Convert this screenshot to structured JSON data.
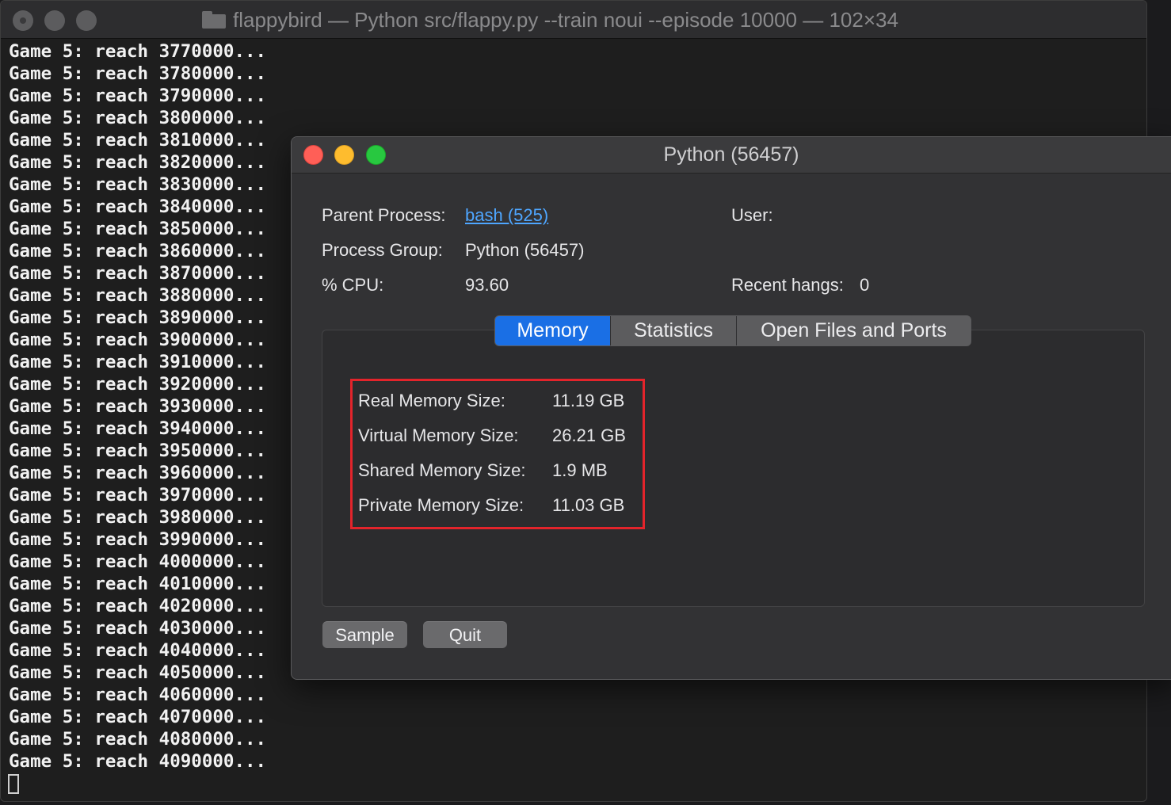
{
  "terminal": {
    "title": "flappybird — Python src/flappy.py --train noui --episode 10000 — 102×34",
    "lines": [
      "Game 5: reach 3770000...",
      "Game 5: reach 3780000...",
      "Game 5: reach 3790000...",
      "Game 5: reach 3800000...",
      "Game 5: reach 3810000...",
      "Game 5: reach 3820000...",
      "Game 5: reach 3830000...",
      "Game 5: reach 3840000...",
      "Game 5: reach 3850000...",
      "Game 5: reach 3860000...",
      "Game 5: reach 3870000...",
      "Game 5: reach 3880000...",
      "Game 5: reach 3890000...",
      "Game 5: reach 3900000...",
      "Game 5: reach 3910000...",
      "Game 5: reach 3920000...",
      "Game 5: reach 3930000...",
      "Game 5: reach 3940000...",
      "Game 5: reach 3950000...",
      "Game 5: reach 3960000...",
      "Game 5: reach 3970000...",
      "Game 5: reach 3980000...",
      "Game 5: reach 3990000...",
      "Game 5: reach 4000000...",
      "Game 5: reach 4010000...",
      "Game 5: reach 4020000...",
      "Game 5: reach 4030000...",
      "Game 5: reach 4040000...",
      "Game 5: reach 4050000...",
      "Game 5: reach 4060000...",
      "Game 5: reach 4070000...",
      "Game 5: reach 4080000...",
      "Game 5: reach 4090000..."
    ]
  },
  "inspector": {
    "title": "Python (56457)",
    "info": {
      "parent_process_label": "Parent Process:",
      "parent_process_value": "bash (525)",
      "user_label": "User:",
      "process_group_label": "Process Group:",
      "process_group_value": "Python (56457)",
      "cpu_label": "% CPU:",
      "cpu_value": "93.60",
      "recent_hangs_label": "Recent hangs:",
      "recent_hangs_value": "0"
    },
    "tabs": [
      "Memory",
      "Statistics",
      "Open Files and Ports"
    ],
    "selected_tab": "Memory",
    "memory": [
      {
        "label": "Real Memory Size:",
        "value": "11.19 GB"
      },
      {
        "label": "Virtual Memory Size:",
        "value": "26.21 GB"
      },
      {
        "label": "Shared Memory Size:",
        "value": "1.9 MB"
      },
      {
        "label": "Private Memory Size:",
        "value": "11.03 GB"
      }
    ],
    "buttons": {
      "sample": "Sample",
      "quit": "Quit"
    }
  },
  "colors": {
    "terminal_bg": "#1e1e1e",
    "terminal_text": "#f2f2f2",
    "inspector_bg": "#323234",
    "selected_tab": "#1a6fe5",
    "link": "#4ea6ff",
    "highlight_box": "#e3242b",
    "close_light": "#ff5f57",
    "minimize_light": "#febc2e",
    "zoom_light": "#28c840"
  }
}
